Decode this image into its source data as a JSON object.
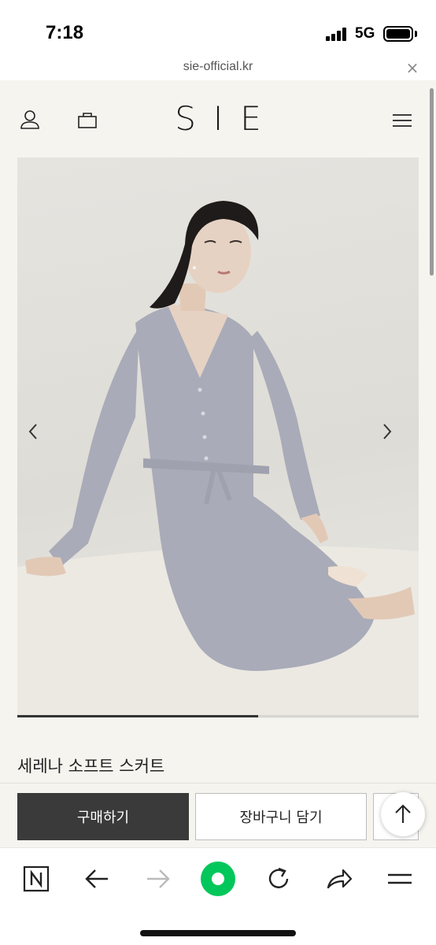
{
  "status_bar": {
    "time": "7:18",
    "network": "5G"
  },
  "browser": {
    "url": "sie-official.kr",
    "close_glyph": "×"
  },
  "site": {
    "logo": "SIE",
    "icons": {
      "account": "user-icon",
      "bag": "shopping-bag-icon",
      "menu": "hamburger-menu-icon"
    }
  },
  "gallery": {
    "image_subject": "model seated wearing grey ribbed knit cardigan and skirt set",
    "prev_icon": "chevron-left-icon",
    "next_icon": "chevron-right-icon",
    "progress": 0.6
  },
  "product": {
    "name": "세레나 소프트 스커트"
  },
  "actions": {
    "buy_label": "구매하기",
    "cart_label": "장바구니 담기",
    "scroll_top_icon": "arrow-up-icon"
  },
  "toolbar": {
    "items": [
      "naver-n-icon",
      "back-arrow-icon",
      "forward-arrow-icon",
      "green-circle-icon",
      "reload-icon",
      "share-icon",
      "menu-icon"
    ]
  },
  "colors": {
    "page_bg": "#f5f4ef",
    "buy_button": "#3a3a3a",
    "accent_green": "#03c75a",
    "knit_grey": "#a9abb8"
  }
}
